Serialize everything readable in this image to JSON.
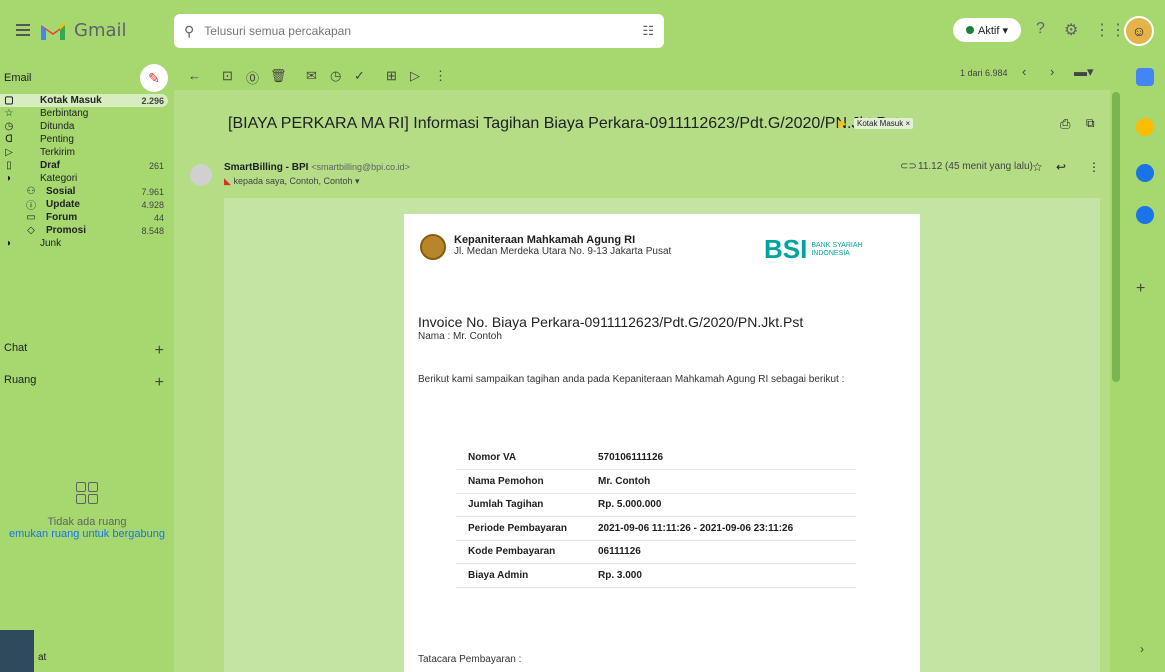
{
  "app": {
    "logo_text": "Gmail",
    "search_placeholder": "Telusuri semua percakapan",
    "status_label": "Aktif ▾"
  },
  "sidebar": {
    "email_label": "Email",
    "items": [
      {
        "label": "Kotak Masuk",
        "count": "2.296",
        "icon": "inbox-icon",
        "glyph": "▢",
        "active": true,
        "bold": true
      },
      {
        "label": "Berbintang",
        "count": "",
        "icon": "star-icon",
        "glyph": "☆"
      },
      {
        "label": "Ditunda",
        "count": "",
        "icon": "clock-icon",
        "glyph": "◷"
      },
      {
        "label": "Penting",
        "count": "",
        "icon": "important-icon",
        "glyph": "ᗡ"
      },
      {
        "label": "Terkirim",
        "count": "",
        "icon": "send-icon",
        "glyph": "▷"
      },
      {
        "label": "Draf",
        "count": "261",
        "icon": "draft-icon",
        "glyph": "▯",
        "bold": true
      },
      {
        "label": "Kategori",
        "count": "",
        "icon": "label-icon",
        "glyph": "◗"
      },
      {
        "label": "Sosial",
        "count": "7.961",
        "icon": "social-icon",
        "glyph": "⚇",
        "sub": true,
        "bold": true
      },
      {
        "label": "Update",
        "count": "4.928",
        "icon": "info-icon",
        "glyph": "ⓘ",
        "sub": true,
        "bold": true
      },
      {
        "label": "Forum",
        "count": "44",
        "icon": "forum-icon",
        "glyph": "▭",
        "sub": true,
        "bold": true
      },
      {
        "label": "Promosi",
        "count": "8.548",
        "icon": "tag-icon",
        "glyph": "◇",
        "sub": true,
        "bold": true
      },
      {
        "label": "Junk",
        "count": "",
        "icon": "label-icon",
        "glyph": "◗"
      }
    ],
    "chat_label": "Chat",
    "rooms_label": "Ruang",
    "empty_rooms_title": "Tidak ada ruang",
    "empty_rooms_link": "emukan ruang untuk bergabung",
    "bottom_chat": "at"
  },
  "toolbar": {
    "pager_text": "1 dari 6.984"
  },
  "message": {
    "subject": "[BIAYA PERKARA MA RI] Informasi Tagihan Biaya Perkara-0911112623/Pdt.G/2020/PN.Jkt.Pst",
    "label_chip": "Kotak Masuk ×",
    "sender_name": "SmartBilling - BPI",
    "sender_email": "<smartbilling@bpi.co.id>",
    "to_line": "kepada saya, Contoh, Contoh ▾",
    "time": "11.12 (45 menit yang lalu)"
  },
  "invoice": {
    "org_name": "Kepaniteraan Mahkamah Agung RI",
    "org_address": "Jl. Medan Merdeka Utara No. 9-13 Jakarta Pusat",
    "bank_logo": "BSI",
    "bank_sub1": "BANK SYARIAH",
    "bank_sub2": "INDONESIA",
    "title": "Invoice No. Biaya Perkara-0911112623/Pdt.G/2020/PN.Jkt.Pst",
    "name_line": "Nama : Mr. Contoh",
    "intro": "Berikut kami sampaikan tagihan anda pada Kepaniteraan Mahkamah Agung RI sebagai berikut :",
    "rows": [
      {
        "label": "Nomor VA",
        "value": "570106111126"
      },
      {
        "label": "Nama Pemohon",
        "value": "Mr. Contoh"
      },
      {
        "label": "Jumlah Tagihan",
        "value": "Rp. 5.000.000"
      },
      {
        "label": "Periode Pembayaran",
        "value": "2021-09-06 11:11:26 - 2021-09-06 23:11:26"
      },
      {
        "label": "Kode Pembayaran",
        "value": "06111126"
      },
      {
        "label": "Biaya Admin",
        "value": "Rp. 3.000"
      }
    ],
    "footer_text": "Tatacara Pembayaran :"
  }
}
